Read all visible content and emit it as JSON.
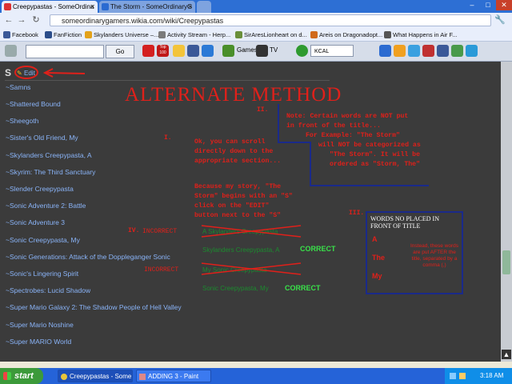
{
  "browser": {
    "tabs": [
      {
        "label": "Creepypastas - SomeOrdina",
        "active": true
      },
      {
        "label": "The Storm - SomeOrdinaryG",
        "active": false
      }
    ],
    "url": "someordinarygamers.wikia.com/wiki/Creepypastas",
    "bookmarks": [
      "Facebook",
      "FanFiction",
      "Skylanders Universe –...",
      "Activity Stream - Herp...",
      "SirAresLionheart on d...",
      "Areis on Dragonadopt...",
      "What Happens in Air F..."
    ],
    "toolbar": {
      "go_label": "Go",
      "games_label": "Games",
      "tv_label": "TV",
      "radio_label": "KCAL",
      "top_badge": "Top 100"
    }
  },
  "page": {
    "letter": "S",
    "edit_label": "Edit",
    "links": [
      "~Samns",
      "~Shattered Bound",
      "~Sheegoth",
      "~Sister's Old Friend, My",
      "~Skylanders Creepypasta, A",
      "~Skyrim: The Third Sanctuary",
      "~Slender Creepypasta",
      "~Sonic Adventure 2: Battle",
      "~Sonic Adventure 3",
      "~Sonic Creepypasta, My",
      "~Sonic Generations: Attack of the Doppleganger Sonic",
      "~Sonic's Lingering Spirit",
      "~Spectrobes: Lucid Shadow",
      "~Super Mario Galaxy 2: The Shadow People of Hell Valley",
      "~Super Mario Noshine",
      "~Super MARIO World"
    ]
  },
  "annotation": {
    "title": "ALTERNATE METHOD",
    "roman_1": "I.",
    "roman_2": "II.",
    "roman_3": "III.",
    "roman_4": "IV.",
    "note_lines": [
      "Note: Certain words are NOT put",
      "in front of the title...",
      "For Example: \"The Storm\"",
      "will NOT be categorized as",
      "\"The Storm\". It will be",
      "ordered as \"Storm, The\""
    ],
    "scroll_lines": [
      "Ok, you can scroll",
      "directly down to the",
      "appropriate section..."
    ],
    "because_lines": [
      "Because my story, \"The",
      "Storm\" begins with an \"S\"",
      "click on the \"EDIT\"",
      "button next to the \"S\""
    ],
    "incorrect_1": "INCORRECT",
    "incorrect_2": "INCORRECT",
    "wrong_1": "A Skylanders Creepypasta",
    "right_1": "Skylanders Creepypasta, A",
    "wrong_2": "My Sonic Creepypasta",
    "right_2": "Sonic Creepypasta, My",
    "correct_1": "CORRECT",
    "correct_2": "CORRECT",
    "box_title": "WORDS NO PLACED IN FRONT OF TITLE",
    "box_words": [
      "A",
      "The",
      "My"
    ],
    "box_explain": "Instead, these words are put AFTER the title, separated by a comma (,)"
  },
  "taskbar": {
    "start_label": "start",
    "tasks": [
      "Creepypastas - Some...",
      "ADDING 3 - Paint"
    ],
    "clock": "3:18 AM"
  },
  "colors": {
    "annotation_red": "#e0201a",
    "link_blue": "#8ab4f8",
    "box_navy": "#1a2a8a",
    "bright_green": "#39e24a"
  }
}
